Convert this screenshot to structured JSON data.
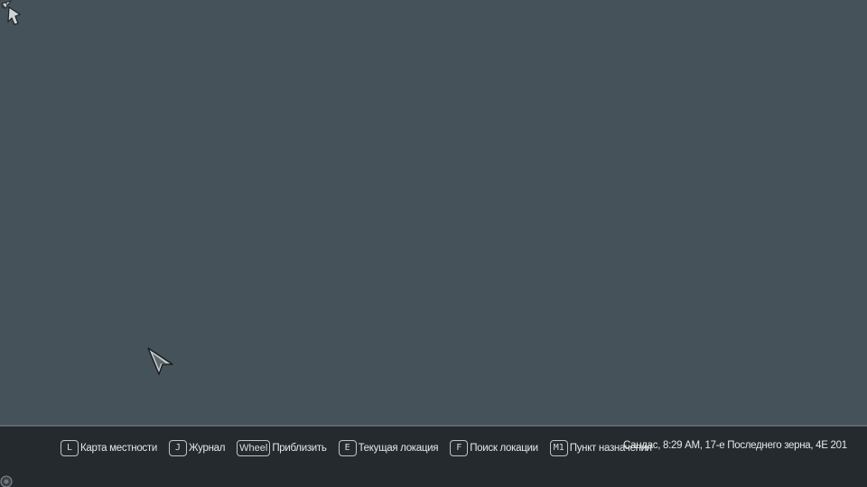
{
  "map": {
    "background_color": "#465259",
    "compass_icon": "player-marker-icon",
    "cursor_icon": "map-cursor-icon"
  },
  "bottom_bar": {
    "hints": [
      {
        "key": "L",
        "label": "Карта местности"
      },
      {
        "key": "J",
        "label": "Журнал"
      },
      {
        "key": "Wheel",
        "label": "Приблизить"
      },
      {
        "key": "E",
        "label": "Текущая локация"
      },
      {
        "key": "F",
        "label": "Поиск локации"
      },
      {
        "key": "M1",
        "label": "Пункт назначения"
      }
    ],
    "status": "Сандас, 8:29 AM, 17-е Последнего зерна, 4E 201"
  }
}
